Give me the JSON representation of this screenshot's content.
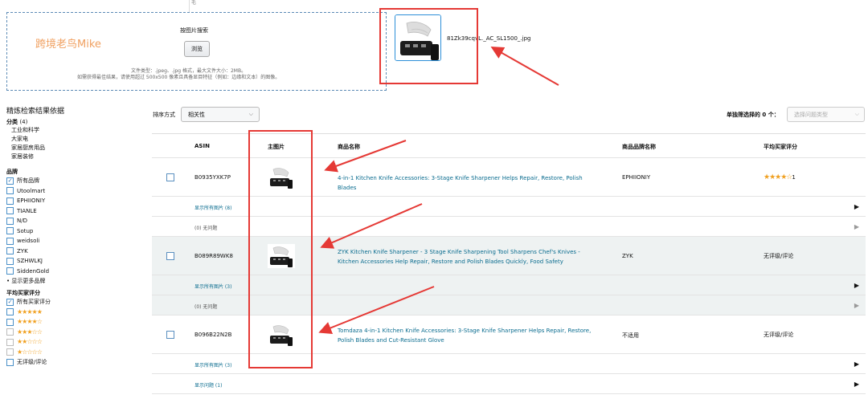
{
  "upload": {
    "top_small": "毛",
    "watermark": "跨境老鸟Mike",
    "title": "按图片搜索",
    "browse_label": "浏览",
    "hint1": "文件类型：.jpeg、.jpg 格式，最大文件大小：2MB。",
    "hint2": "如需获得最佳结果，请使用超过 500x500 像素且具备显目特征（例如：边缘和文本）的图像。"
  },
  "preview": {
    "filename": "81Zk39cqvL._AC_SL1500_.jpg"
  },
  "sidebar": {
    "heading": "精炼检索结果依据",
    "category_title": "分类",
    "category_count": "(4)",
    "categories": [
      "工业和科学",
      "大家电",
      "家居厨房用品",
      "家居装修"
    ],
    "brand_title": "品牌",
    "brands": [
      {
        "label": "所有品牌",
        "checked": true
      },
      {
        "label": "Utoolmart",
        "checked": false
      },
      {
        "label": "EPHIIONIY",
        "checked": false
      },
      {
        "label": "TIANLE",
        "checked": false
      },
      {
        "label": "N/D",
        "checked": false
      },
      {
        "label": "Sotup",
        "checked": false
      },
      {
        "label": "weidsoli",
        "checked": false
      },
      {
        "label": "ZYK",
        "checked": false
      },
      {
        "label": "SZHWLKJ",
        "checked": false
      },
      {
        "label": "SiddenGold",
        "checked": false
      }
    ],
    "more_brands": "• 显示更多品牌",
    "rating_title": "平均买家评分",
    "ratings": [
      {
        "label": "所有买家评分",
        "checked": true,
        "stars": ""
      },
      {
        "label": "",
        "checked": false,
        "stars": "★★★★★"
      },
      {
        "label": "",
        "checked": false,
        "stars": "★★★★☆"
      },
      {
        "label": "",
        "checked": false,
        "stars": "★★★☆☆"
      },
      {
        "label": "",
        "checked": false,
        "stars": "★★☆☆☆"
      },
      {
        "label": "",
        "checked": false,
        "stars": "★☆☆☆☆"
      },
      {
        "label": "无评级/评论",
        "checked": false,
        "stars": ""
      }
    ]
  },
  "toolbar": {
    "sort_label": "排序方式",
    "sort_value": "相关性",
    "selected_count": "单独筛选择的 0 个：",
    "bulk_placeholder": "选择问题类型"
  },
  "table": {
    "headers": {
      "asin": "ASIN",
      "image": "主图片",
      "title": "商品名称",
      "brand": "商品品牌名称",
      "rating": "平均买家评分"
    },
    "rows": [
      {
        "asin": "B0935YXK7P",
        "title": "4-in-1 Kitchen Knife Accessories: 3-Stage Knife Sharpener Helps Repair, Restore, Polish Blades",
        "brand": "EPHIIONIY",
        "rating_stars": "★★★★☆",
        "rating_count": "1",
        "rating_text": "",
        "sub1": "显示所有图片 (8)",
        "sub2": "(0) 无问题"
      },
      {
        "asin": "B089R89WK8",
        "title": "ZYK Kitchen Knife Sharpener - 3 Stage Knife Sharpening Tool Sharpens Chef's Knives - Kitchen Accessories Help Repair, Restore and Polish Blades Quickly, Food Safety",
        "brand": "ZYK",
        "rating_stars": "",
        "rating_count": "",
        "rating_text": "无评级/评论",
        "sub1": "显示所有图片 (3)",
        "sub2": "(0) 无问题"
      },
      {
        "asin": "B096B22N2B",
        "title": "Tomdaza 4-in-1 Kitchen Knife Accessories: 3-Stage Knife Sharpener Helps Repair, Restore, Polish Blades and Cut-Resistant Glove",
        "brand": "不适用",
        "rating_stars": "",
        "rating_count": "",
        "rating_text": "无评级/评论",
        "sub1": "显示所有图片 (3)",
        "sub2": "显示问题 (1)"
      }
    ]
  },
  "colors": {
    "link": "#0a6c8f",
    "star": "#f0a020",
    "annotation": "#e53935",
    "dashed_border": "#5b8ab5"
  }
}
